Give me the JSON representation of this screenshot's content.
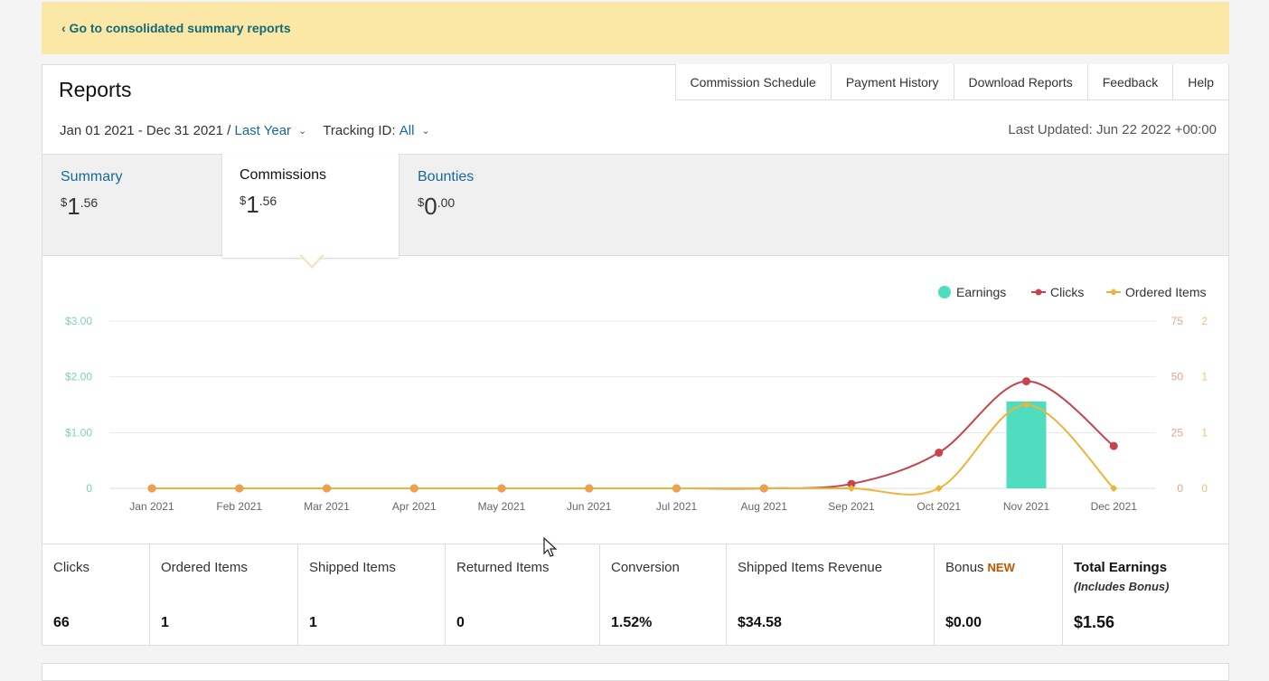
{
  "banner": {
    "link": "‹ Go to consolidated summary reports"
  },
  "header": {
    "title": "Reports",
    "links": [
      "Commission Schedule",
      "Payment History",
      "Download Reports",
      "Feedback",
      "Help"
    ],
    "date_range": "Jan 01 2021 - Dec 31 2021 /",
    "period_select": "Last Year",
    "tracking_label": "Tracking ID:",
    "tracking_value": "All",
    "last_updated": "Last Updated: Jun 22 2022 +00:00"
  },
  "tabs": [
    {
      "name": "Summary",
      "currency": "$",
      "whole": "1",
      "cents": ".56",
      "active": false
    },
    {
      "name": "Commissions",
      "currency": "$",
      "whole": "1",
      "cents": ".56",
      "active": true
    },
    {
      "name": "Bounties",
      "currency": "$",
      "whole": "0",
      "cents": ".00",
      "active": false
    }
  ],
  "chart_data": {
    "type": "bar",
    "categories": [
      "Jan 2021",
      "Feb 2021",
      "Mar 2021",
      "Apr 2021",
      "May 2021",
      "Jun 2021",
      "Jul 2021",
      "Aug 2021",
      "Sep 2021",
      "Oct 2021",
      "Nov 2021",
      "Dec 2021"
    ],
    "series": [
      {
        "name": "Earnings",
        "kind": "bar",
        "axis": "left",
        "color": "#4fdcbf",
        "values": [
          0,
          0,
          0,
          0,
          0,
          0,
          0,
          0,
          0,
          0,
          1.56,
          0
        ]
      },
      {
        "name": "Clicks",
        "kind": "line",
        "axis": "right1",
        "color": "#c8444c",
        "values": [
          0,
          0,
          0,
          0,
          0,
          0,
          0,
          0,
          2,
          16,
          48,
          19
        ]
      },
      {
        "name": "Ordered Items",
        "kind": "line",
        "axis": "right2",
        "color": "#f0b33a",
        "values": [
          0,
          0,
          0,
          0,
          0,
          0,
          0,
          0,
          0,
          0,
          1,
          0
        ]
      }
    ],
    "left_axis": {
      "ticks": [
        "$3.00",
        "$2.00",
        "$1.00",
        "0"
      ],
      "range": [
        0,
        3
      ]
    },
    "right_axis_1": {
      "ticks": [
        "75",
        "50",
        "25",
        "0"
      ],
      "range": [
        0,
        75
      ]
    },
    "right_axis_2": {
      "ticks": [
        "2",
        "1",
        "1",
        "0"
      ],
      "range": [
        0,
        2
      ]
    },
    "legend_position": "top-right",
    "grid": true
  },
  "stats": [
    {
      "label": "Clicks",
      "value": "66"
    },
    {
      "label": "Ordered Items",
      "value": "1"
    },
    {
      "label": "Shipped Items",
      "value": "1"
    },
    {
      "label": "Returned Items",
      "value": "0"
    },
    {
      "label": "Conversion",
      "value": "1.52%"
    },
    {
      "label": "Shipped Items Revenue",
      "value": "$34.58"
    },
    {
      "label": "Bonus",
      "badge": "NEW",
      "value": "$0.00"
    },
    {
      "label": "Total Earnings",
      "sublabel": "(Includes Bonus)",
      "value": "$1.56"
    }
  ]
}
